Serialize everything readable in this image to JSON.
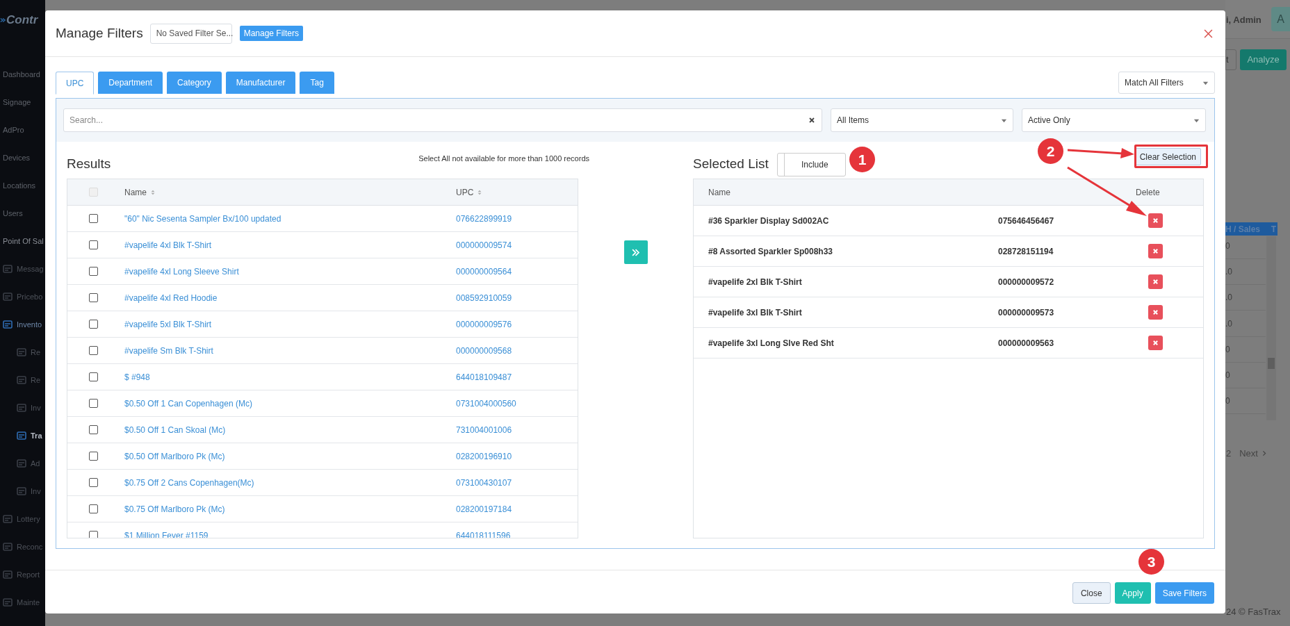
{
  "background": {
    "logo": "Contr",
    "sidebar": [
      {
        "label": "Dashboard",
        "kind": "top",
        "selected": false
      },
      {
        "label": "Signage",
        "kind": "top",
        "selected": false
      },
      {
        "label": "AdPro",
        "kind": "top",
        "selected": false
      },
      {
        "label": "Devices",
        "kind": "top",
        "selected": false
      },
      {
        "label": "Locations",
        "kind": "top",
        "selected": false
      },
      {
        "label": "Users",
        "kind": "top",
        "selected": false
      },
      {
        "label": "Point Of Sal",
        "kind": "section",
        "selected": false
      },
      {
        "label": "Messag",
        "kind": "item",
        "selected": false
      },
      {
        "label": "Pricebo",
        "kind": "item",
        "selected": false
      },
      {
        "label": "Invento",
        "kind": "item",
        "selected": true
      },
      {
        "label": "Re",
        "kind": "sub",
        "selected": false
      },
      {
        "label": "Re",
        "kind": "sub",
        "selected": false
      },
      {
        "label": "Inv",
        "kind": "sub",
        "selected": false
      },
      {
        "label": "Tra",
        "kind": "sub",
        "selected": true
      },
      {
        "label": "Ad",
        "kind": "sub",
        "selected": false
      },
      {
        "label": "Inv",
        "kind": "sub",
        "selected": false
      },
      {
        "label": "Lottery",
        "kind": "item",
        "selected": false
      },
      {
        "label": "Reconc",
        "kind": "item",
        "selected": false
      },
      {
        "label": "Report",
        "kind": "item",
        "selected": false
      },
      {
        "label": "Mainte",
        "kind": "item",
        "selected": false
      }
    ],
    "user": "i, Admin",
    "avatar": "A",
    "toolbar_buttons": [
      "t",
      "Analyze"
    ],
    "table_header": [
      "H / Sales",
      "T"
    ],
    "table_values": [
      "0",
      ".0",
      ".0",
      ".0",
      "0",
      "0",
      "0"
    ],
    "pagination": [
      "2",
      "Next"
    ],
    "footer": "24 © FasTrax"
  },
  "modal": {
    "title": "Manage Filters",
    "saved_filter": "No Saved Filter Se...",
    "manage_button": "Manage Filters",
    "tabs": [
      {
        "label": "UPC",
        "selected": true
      },
      {
        "label": "Department",
        "selected": false
      },
      {
        "label": "Category",
        "selected": false
      },
      {
        "label": "Manufacturer",
        "selected": false
      },
      {
        "label": "Tag",
        "selected": false
      }
    ],
    "match": "Match All Filters",
    "search": {
      "placeholder": "Search..."
    },
    "item_filter": "All Items",
    "status_filter": "Active Only",
    "results": {
      "title": "Results",
      "note": "Select All not available for more than 1000 records",
      "select_all": {
        "checked": false,
        "disabled": true
      },
      "columns": [
        "Name",
        "UPC"
      ],
      "rows": [
        {
          "name": "\"60\" Nic Sesenta Sampler Bx/100 updated",
          "upc": "076622899919",
          "checked": false
        },
        {
          "name": "#vapelife 4xl Blk T-Shirt",
          "upc": "000000009574",
          "checked": false
        },
        {
          "name": "#vapelife 4xl Long Sleeve Shirt",
          "upc": "000000009564",
          "checked": false
        },
        {
          "name": "#vapelife 4xl Red Hoodie",
          "upc": "008592910059",
          "checked": false
        },
        {
          "name": "#vapelife 5xl Blk T-Shirt",
          "upc": "000000009576",
          "checked": false
        },
        {
          "name": "#vapelife Sm Blk T-Shirt",
          "upc": "000000009568",
          "checked": false
        },
        {
          "name": "$ #948",
          "upc": "644018109487",
          "checked": false
        },
        {
          "name": "$0.50 Off 1 Can Copenhagen (Mc)",
          "upc": "0731004000560",
          "checked": false
        },
        {
          "name": "$0.50 Off 1 Can Skoal (Mc)",
          "upc": "731004001006",
          "checked": false
        },
        {
          "name": "$0.50 Off Marlboro Pk (Mc)",
          "upc": "028200196910",
          "checked": false
        },
        {
          "name": "$0.75 Off 2 Cans Copenhagen(Mc)",
          "upc": "073100430107",
          "checked": false
        },
        {
          "name": "$0.75 Off Marlboro Pk (Mc)",
          "upc": "028200197184",
          "checked": false
        },
        {
          "name": "$1 Million Fever #1159",
          "upc": "644018111596",
          "checked": false
        }
      ]
    },
    "selected_list": {
      "title": "Selected List",
      "mode": "Include",
      "clear_button": "Clear Selection",
      "columns": [
        "Name",
        "Delete"
      ],
      "rows": [
        {
          "name": "#36 Sparkler Display Sd002AC",
          "upc": "075646456467"
        },
        {
          "name": "#8 Assorted Sparkler Sp008h33",
          "upc": "028728151194"
        },
        {
          "name": "#vapelife 2xl Blk T-Shirt",
          "upc": "000000009572"
        },
        {
          "name": "#vapelife 3xl Blk T-Shirt",
          "upc": "000000009573"
        },
        {
          "name": "#vapelife 3xl Long Slve Red Sht",
          "upc": "000000009563"
        }
      ]
    },
    "footer_buttons": [
      {
        "label": "Close",
        "kind": "default"
      },
      {
        "label": "Apply",
        "kind": "success"
      },
      {
        "label": "Save Filters",
        "kind": "primary"
      }
    ]
  },
  "annotations": [
    {
      "number": "1"
    },
    {
      "number": "2"
    },
    {
      "number": "3"
    }
  ]
}
